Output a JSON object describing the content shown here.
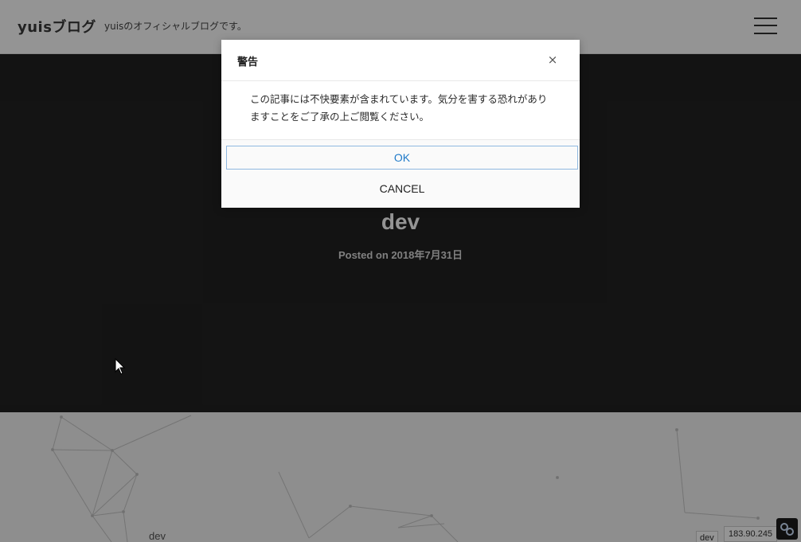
{
  "header": {
    "logo": "yuisブログ",
    "tagline": "yuisのオフィシャルブログです。"
  },
  "hero": {
    "title": "dev",
    "meta": "Posted on 2018年7月31日"
  },
  "content": {
    "category": "dev",
    "tag": "dev",
    "ip": "183.90.245"
  },
  "modal": {
    "title": "警告",
    "close": "×",
    "message": "この記事には不快要素が含まれています。気分を害する恐れがありますことをご了承の上ご閲覧ください。",
    "ok_label": "OK",
    "cancel_label": "CANCEL"
  },
  "colors": {
    "accent": "#1f7ac9",
    "hero_bg": "#222222"
  }
}
